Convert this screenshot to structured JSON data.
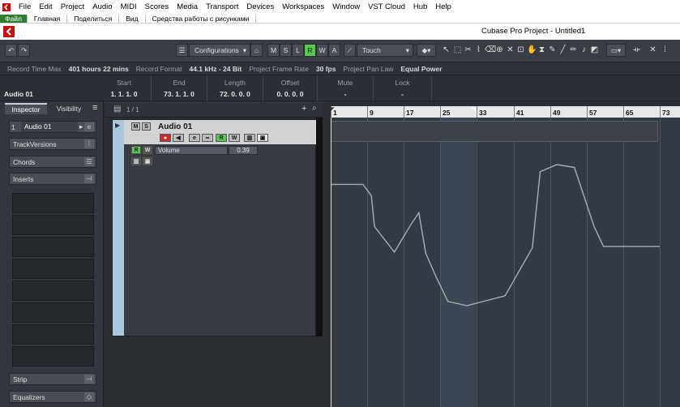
{
  "menubar": {
    "items": [
      "File",
      "Edit",
      "Project",
      "Audio",
      "MIDI",
      "Scores",
      "Media",
      "Transport",
      "Devices",
      "Workspaces",
      "Window",
      "VST Cloud",
      "Hub",
      "Help"
    ]
  },
  "ribbon": {
    "tabs": [
      "Файл",
      "Главная",
      "Поделиться",
      "Вид",
      "Средства работы с рисунками"
    ]
  },
  "window": {
    "title": "Cubase Pro Project - Untitled1"
  },
  "toolbar": {
    "configurations_label": "Configurations",
    "mode_buttons": [
      "M",
      "S",
      "L",
      "R",
      "W",
      "A"
    ],
    "automation_mode": "Touch"
  },
  "infoline": {
    "items": [
      {
        "label": "Record Time Max",
        "value": "401 hours 22 mins"
      },
      {
        "label": "Record Format",
        "value": "44.1 kHz - 24 Bit"
      },
      {
        "label": "Project Frame Rate",
        "value": "30 fps"
      },
      {
        "label": "Project Pan Law",
        "value": "Equal Power"
      }
    ]
  },
  "eventinfo": {
    "track_name": "Audio 01",
    "columns": [
      {
        "header": "Start",
        "value": "1. 1. 1.   0"
      },
      {
        "header": "End",
        "value": "73. 1. 1.   0"
      },
      {
        "header": "Length",
        "value": "72. 0. 0.   0"
      },
      {
        "header": "Offset",
        "value": "0. 0. 0.   0"
      },
      {
        "header": "Mute",
        "value": "-"
      },
      {
        "header": "Lock",
        "value": "-"
      }
    ]
  },
  "inspector": {
    "tabs": [
      "Inspector",
      "Visibility"
    ],
    "track_number": "1",
    "track_name": "Audio 01",
    "sections": [
      "TrackVersions",
      "Chords",
      "Inserts",
      "Strip",
      "Equalizers"
    ]
  },
  "tracklist": {
    "counter": "1 / 1",
    "track": {
      "name": "Audio 01",
      "automation_param": "Volume",
      "automation_value": "0.39"
    }
  },
  "ruler": {
    "marks": [
      "1",
      "9",
      "17",
      "25",
      "33",
      "41",
      "49",
      "57",
      "65",
      "73"
    ]
  },
  "automation": {
    "points": [
      [
        0,
        0.86
      ],
      [
        7.7,
        0.86
      ],
      [
        9.5,
        0.78
      ],
      [
        10.2,
        0.56
      ],
      [
        14.5,
        0.38
      ],
      [
        18.0,
        0.57
      ],
      [
        19.8,
        0.66
      ],
      [
        21.3,
        0.37
      ],
      [
        23.6,
        0.2
      ],
      [
        26.1,
        0.03
      ],
      [
        30.2,
        0.0
      ],
      [
        38.5,
        0.07
      ],
      [
        44.4,
        0.41
      ],
      [
        46.1,
        0.95
      ],
      [
        49.7,
        1.0
      ],
      [
        53.5,
        0.98
      ],
      [
        57.8,
        0.56
      ],
      [
        59.8,
        0.42
      ],
      [
        72.0,
        0.42
      ]
    ]
  }
}
